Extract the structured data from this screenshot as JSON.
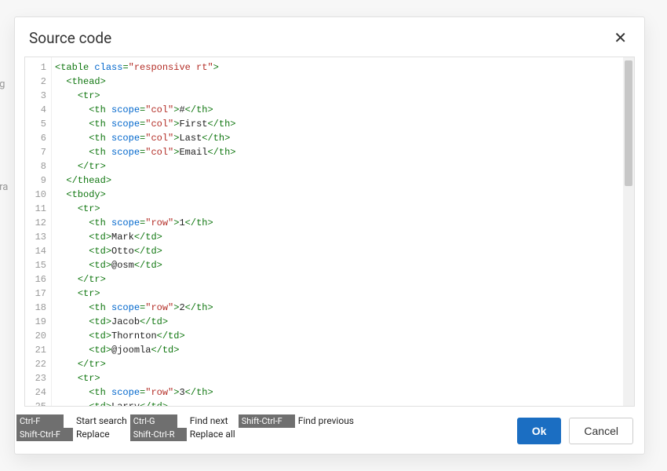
{
  "bg": {
    "frag1": "ng",
    "frag2": "ara"
  },
  "modal": {
    "title": "Source code",
    "close_glyph": "✕",
    "buttons": {
      "ok": "Ok",
      "cancel": "Cancel"
    },
    "shortcuts": [
      {
        "key": "Ctrl-F",
        "label": "Start search"
      },
      {
        "key": "Ctrl-G",
        "label": "Find next"
      },
      {
        "key": "Shift-Ctrl-F",
        "label": "Find previous"
      },
      {
        "key": "Shift-Ctrl-F",
        "label": "Replace"
      },
      {
        "key": "Shift-Ctrl-R",
        "label": "Replace all"
      }
    ]
  },
  "code_lines": [
    [
      [
        "tag",
        "<table"
      ],
      [
        "text",
        " "
      ],
      [
        "attr",
        "class"
      ],
      [
        "punct",
        "="
      ],
      [
        "str",
        "\"responsive rt\""
      ],
      [
        "tag",
        ">"
      ]
    ],
    [
      [
        "text",
        "  "
      ],
      [
        "tag",
        "<thead>"
      ]
    ],
    [
      [
        "text",
        "    "
      ],
      [
        "tag",
        "<tr>"
      ]
    ],
    [
      [
        "text",
        "      "
      ],
      [
        "tag",
        "<th"
      ],
      [
        "text",
        " "
      ],
      [
        "attr",
        "scope"
      ],
      [
        "punct",
        "="
      ],
      [
        "str",
        "\"col\""
      ],
      [
        "tag",
        ">"
      ],
      [
        "text",
        "#"
      ],
      [
        "tag",
        "</th>"
      ]
    ],
    [
      [
        "text",
        "      "
      ],
      [
        "tag",
        "<th"
      ],
      [
        "text",
        " "
      ],
      [
        "attr",
        "scope"
      ],
      [
        "punct",
        "="
      ],
      [
        "str",
        "\"col\""
      ],
      [
        "tag",
        ">"
      ],
      [
        "text",
        "First"
      ],
      [
        "tag",
        "</th>"
      ]
    ],
    [
      [
        "text",
        "      "
      ],
      [
        "tag",
        "<th"
      ],
      [
        "text",
        " "
      ],
      [
        "attr",
        "scope"
      ],
      [
        "punct",
        "="
      ],
      [
        "str",
        "\"col\""
      ],
      [
        "tag",
        ">"
      ],
      [
        "text",
        "Last"
      ],
      [
        "tag",
        "</th>"
      ]
    ],
    [
      [
        "text",
        "      "
      ],
      [
        "tag",
        "<th"
      ],
      [
        "text",
        " "
      ],
      [
        "attr",
        "scope"
      ],
      [
        "punct",
        "="
      ],
      [
        "str",
        "\"col\""
      ],
      [
        "tag",
        ">"
      ],
      [
        "text",
        "Email"
      ],
      [
        "tag",
        "</th>"
      ]
    ],
    [
      [
        "text",
        "    "
      ],
      [
        "tag",
        "</tr>"
      ]
    ],
    [
      [
        "text",
        "  "
      ],
      [
        "tag",
        "</thead>"
      ]
    ],
    [
      [
        "text",
        "  "
      ],
      [
        "tag",
        "<tbody>"
      ]
    ],
    [
      [
        "text",
        "    "
      ],
      [
        "tag",
        "<tr>"
      ]
    ],
    [
      [
        "text",
        "      "
      ],
      [
        "tag",
        "<th"
      ],
      [
        "text",
        " "
      ],
      [
        "attr",
        "scope"
      ],
      [
        "punct",
        "="
      ],
      [
        "str",
        "\"row\""
      ],
      [
        "tag",
        ">"
      ],
      [
        "text",
        "1"
      ],
      [
        "tag",
        "</th>"
      ]
    ],
    [
      [
        "text",
        "      "
      ],
      [
        "tag",
        "<td>"
      ],
      [
        "text",
        "Mark"
      ],
      [
        "tag",
        "</td>"
      ]
    ],
    [
      [
        "text",
        "      "
      ],
      [
        "tag",
        "<td>"
      ],
      [
        "text",
        "Otto"
      ],
      [
        "tag",
        "</td>"
      ]
    ],
    [
      [
        "text",
        "      "
      ],
      [
        "tag",
        "<td>"
      ],
      [
        "text",
        "@osm"
      ],
      [
        "tag",
        "</td>"
      ]
    ],
    [
      [
        "text",
        "    "
      ],
      [
        "tag",
        "</tr>"
      ]
    ],
    [
      [
        "text",
        "    "
      ],
      [
        "tag",
        "<tr>"
      ]
    ],
    [
      [
        "text",
        "      "
      ],
      [
        "tag",
        "<th"
      ],
      [
        "text",
        " "
      ],
      [
        "attr",
        "scope"
      ],
      [
        "punct",
        "="
      ],
      [
        "str",
        "\"row\""
      ],
      [
        "tag",
        ">"
      ],
      [
        "text",
        "2"
      ],
      [
        "tag",
        "</th>"
      ]
    ],
    [
      [
        "text",
        "      "
      ],
      [
        "tag",
        "<td>"
      ],
      [
        "text",
        "Jacob"
      ],
      [
        "tag",
        "</td>"
      ]
    ],
    [
      [
        "text",
        "      "
      ],
      [
        "tag",
        "<td>"
      ],
      [
        "text",
        "Thornton"
      ],
      [
        "tag",
        "</td>"
      ]
    ],
    [
      [
        "text",
        "      "
      ],
      [
        "tag",
        "<td>"
      ],
      [
        "text",
        "@joomla"
      ],
      [
        "tag",
        "</td>"
      ]
    ],
    [
      [
        "text",
        "    "
      ],
      [
        "tag",
        "</tr>"
      ]
    ],
    [
      [
        "text",
        "    "
      ],
      [
        "tag",
        "<tr>"
      ]
    ],
    [
      [
        "text",
        "      "
      ],
      [
        "tag",
        "<th"
      ],
      [
        "text",
        " "
      ],
      [
        "attr",
        "scope"
      ],
      [
        "punct",
        "="
      ],
      [
        "str",
        "\"row\""
      ],
      [
        "tag",
        ">"
      ],
      [
        "text",
        "3"
      ],
      [
        "tag",
        "</th>"
      ]
    ],
    [
      [
        "text",
        "      "
      ],
      [
        "tag",
        "<td>"
      ],
      [
        "text",
        "Larry"
      ],
      [
        "tag",
        "</td>"
      ]
    ]
  ]
}
